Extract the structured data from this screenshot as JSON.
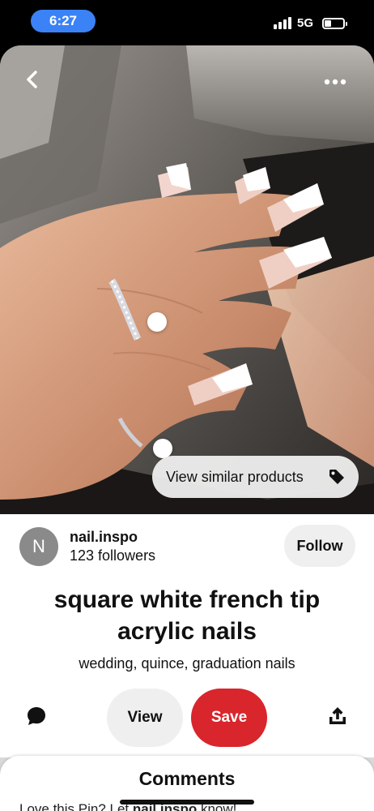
{
  "status": {
    "time": "6:27",
    "network": "5G"
  },
  "actions": {
    "view_similar": "View similar products"
  },
  "creator": {
    "initial": "N",
    "name": "nail.inspo",
    "followers": "123 followers",
    "follow_label": "Follow"
  },
  "pin": {
    "title": "square white french tip acrylic nails",
    "description": "wedding, quince, graduation nails"
  },
  "buttons": {
    "view": "View",
    "save": "Save"
  },
  "comments": {
    "title": "Comments",
    "prompt_prefix": "Love this Pin? Let ",
    "prompt_user": "nail.inspo",
    "prompt_suffix": " know!"
  },
  "colors": {
    "save": "#d9252c",
    "time_pill": "#3b82f6",
    "button_gray": "#efefef",
    "avatar": "#8a8a8a"
  },
  "icons": [
    "back-icon",
    "more-icon",
    "tag-icon",
    "comment-icon",
    "share-icon"
  ]
}
